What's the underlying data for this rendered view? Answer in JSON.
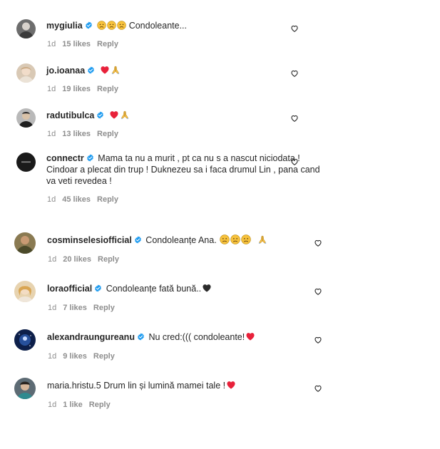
{
  "comments": [
    {
      "user": "mygiulia",
      "text": "Condoleante...",
      "time": "1d",
      "likes": "15 likes",
      "reply": "Reply"
    },
    {
      "user": "jo.ioanaa",
      "text": "",
      "time": "1d",
      "likes": "19 likes",
      "reply": "Reply"
    },
    {
      "user": "radutibulca",
      "text": "",
      "time": "1d",
      "likes": "13 likes",
      "reply": "Reply"
    },
    {
      "user": "connectr",
      "text": "Mama ta nu a murit , pt ca nu s a nascut niciodata ! Cindoar a plecat din trup ! Duknezeu sa i faca drumul Lin , pana cand va veti revedea !",
      "time": "1d",
      "likes": "45 likes",
      "reply": "Reply"
    },
    {
      "user": "cosminselesiofficial",
      "text": "Condoleanțe Ana.",
      "time": "1d",
      "likes": "20 likes",
      "reply": "Reply"
    },
    {
      "user": "loraofficial",
      "text": "Condoleanțe fată bună..",
      "time": "1d",
      "likes": "7 likes",
      "reply": "Reply"
    },
    {
      "user": "alexandraungureanu",
      "text": "Nu cred:((( condoleante!",
      "time": "1d",
      "likes": "9 likes",
      "reply": "Reply"
    },
    {
      "user": "maria.hristu.5",
      "text": "Drum lin și lumină mamei tale !",
      "time": "1d",
      "likes": "1 like",
      "reply": "Reply"
    }
  ],
  "icons": {
    "verified": "verified-badge-icon",
    "like": "heart-outline-icon",
    "sad": "sad-face-emoji",
    "red_heart": "red-heart-emoji",
    "black_heart": "black-heart-emoji",
    "pray": "folded-hands-emoji"
  },
  "colors": {
    "verified": "#1d9bf0",
    "text": "#262626",
    "muted": "#8e8e8e",
    "red": "#e8213a"
  }
}
